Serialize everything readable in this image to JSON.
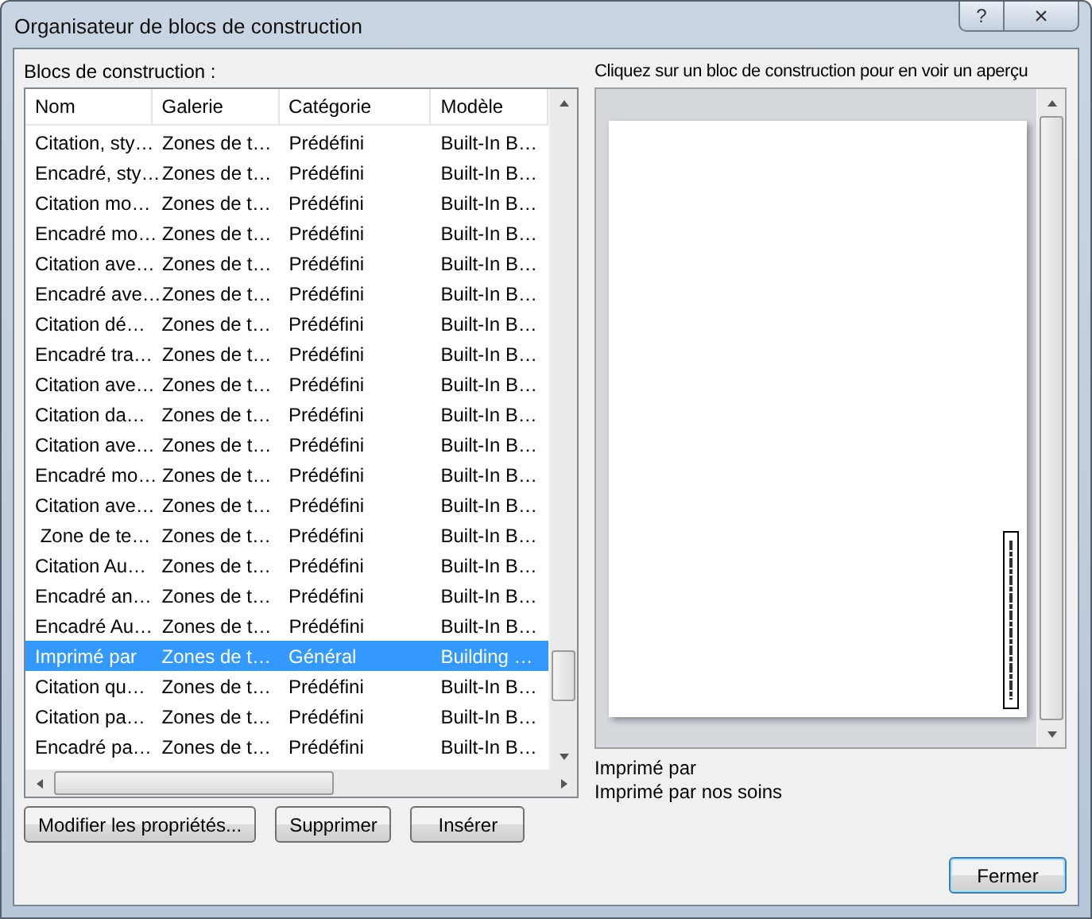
{
  "window": {
    "title": "Organisateur de blocs de construction",
    "buttons": [
      "?",
      "×"
    ]
  },
  "list_label": "Blocs de construction :",
  "table": {
    "columns": [
      "Nom",
      "Galerie",
      "Catégorie",
      "Modèle"
    ],
    "rows": [
      {
        "cells": [
          "Citation, sty…",
          "Zones de t…",
          "Prédéfini",
          "Built-In B…"
        ],
        "selected": false
      },
      {
        "cells": [
          "Encadré, sty…",
          "Zones de t…",
          "Prédéfini",
          "Built-In B…"
        ],
        "selected": false
      },
      {
        "cells": [
          "Citation mo…",
          "Zones de t…",
          "Prédéfini",
          "Built-In B…"
        ],
        "selected": false
      },
      {
        "cells": [
          "Encadré mo…",
          "Zones de t…",
          "Prédéfini",
          "Built-In B…"
        ],
        "selected": false
      },
      {
        "cells": [
          "Citation ave…",
          "Zones de t…",
          "Prédéfini",
          "Built-In B…"
        ],
        "selected": false
      },
      {
        "cells": [
          "Encadré ave…",
          "Zones de t…",
          "Prédéfini",
          "Built-In B…"
        ],
        "selected": false
      },
      {
        "cells": [
          "Citation dé…",
          "Zones de t…",
          "Prédéfini",
          "Built-In B…"
        ],
        "selected": false
      },
      {
        "cells": [
          "Encadré tra…",
          "Zones de t…",
          "Prédéfini",
          "Built-In B…"
        ],
        "selected": false
      },
      {
        "cells": [
          "Citation ave…",
          "Zones de t…",
          "Prédéfini",
          "Built-In B…"
        ],
        "selected": false
      },
      {
        "cells": [
          "Citation da…",
          "Zones de t…",
          "Prédéfini",
          "Built-In B…"
        ],
        "selected": false
      },
      {
        "cells": [
          "Citation ave…",
          "Zones de t…",
          "Prédéfini",
          "Built-In B…"
        ],
        "selected": false
      },
      {
        "cells": [
          "Encadré mo…",
          "Zones de t…",
          "Prédéfini",
          "Built-In B…"
        ],
        "selected": false
      },
      {
        "cells": [
          "Citation ave…",
          "Zones de t…",
          "Prédéfini",
          "Built-In B…"
        ],
        "selected": false
      },
      {
        "cells": [
          " Zone de te…",
          "Zones de t…",
          "Prédéfini",
          "Built-In B…"
        ],
        "selected": false
      },
      {
        "cells": [
          "Citation Au…",
          "Zones de t…",
          "Prédéfini",
          "Built-In B…"
        ],
        "selected": false
      },
      {
        "cells": [
          "Encadré an…",
          "Zones de t…",
          "Prédéfini",
          "Built-In B…"
        ],
        "selected": false
      },
      {
        "cells": [
          "Encadré Au…",
          "Zones de t…",
          "Prédéfini",
          "Built-In B…"
        ],
        "selected": false
      },
      {
        "cells": [
          "Imprimé par",
          "Zones de t…",
          "Général",
          "Building …"
        ],
        "selected": true
      },
      {
        "cells": [
          "Citation qu…",
          "Zones de t…",
          "Prédéfini",
          "Built-In B…"
        ],
        "selected": false
      },
      {
        "cells": [
          "Citation pa…",
          "Zones de t…",
          "Prédéfini",
          "Built-In B…"
        ],
        "selected": false
      },
      {
        "cells": [
          "Encadré pa…",
          "Zones de t…",
          "Prédéfini",
          "Built-In B…"
        ],
        "selected": false
      }
    ]
  },
  "actions": [
    "Modifier les propriétés...",
    "Supprimer",
    "Insérer"
  ],
  "preview": {
    "label": "Cliquez sur un bloc de construction pour en voir un aperçu",
    "name": "Imprimé par",
    "description": "Imprimé par nos soins"
  },
  "close_button": "Fermer"
}
